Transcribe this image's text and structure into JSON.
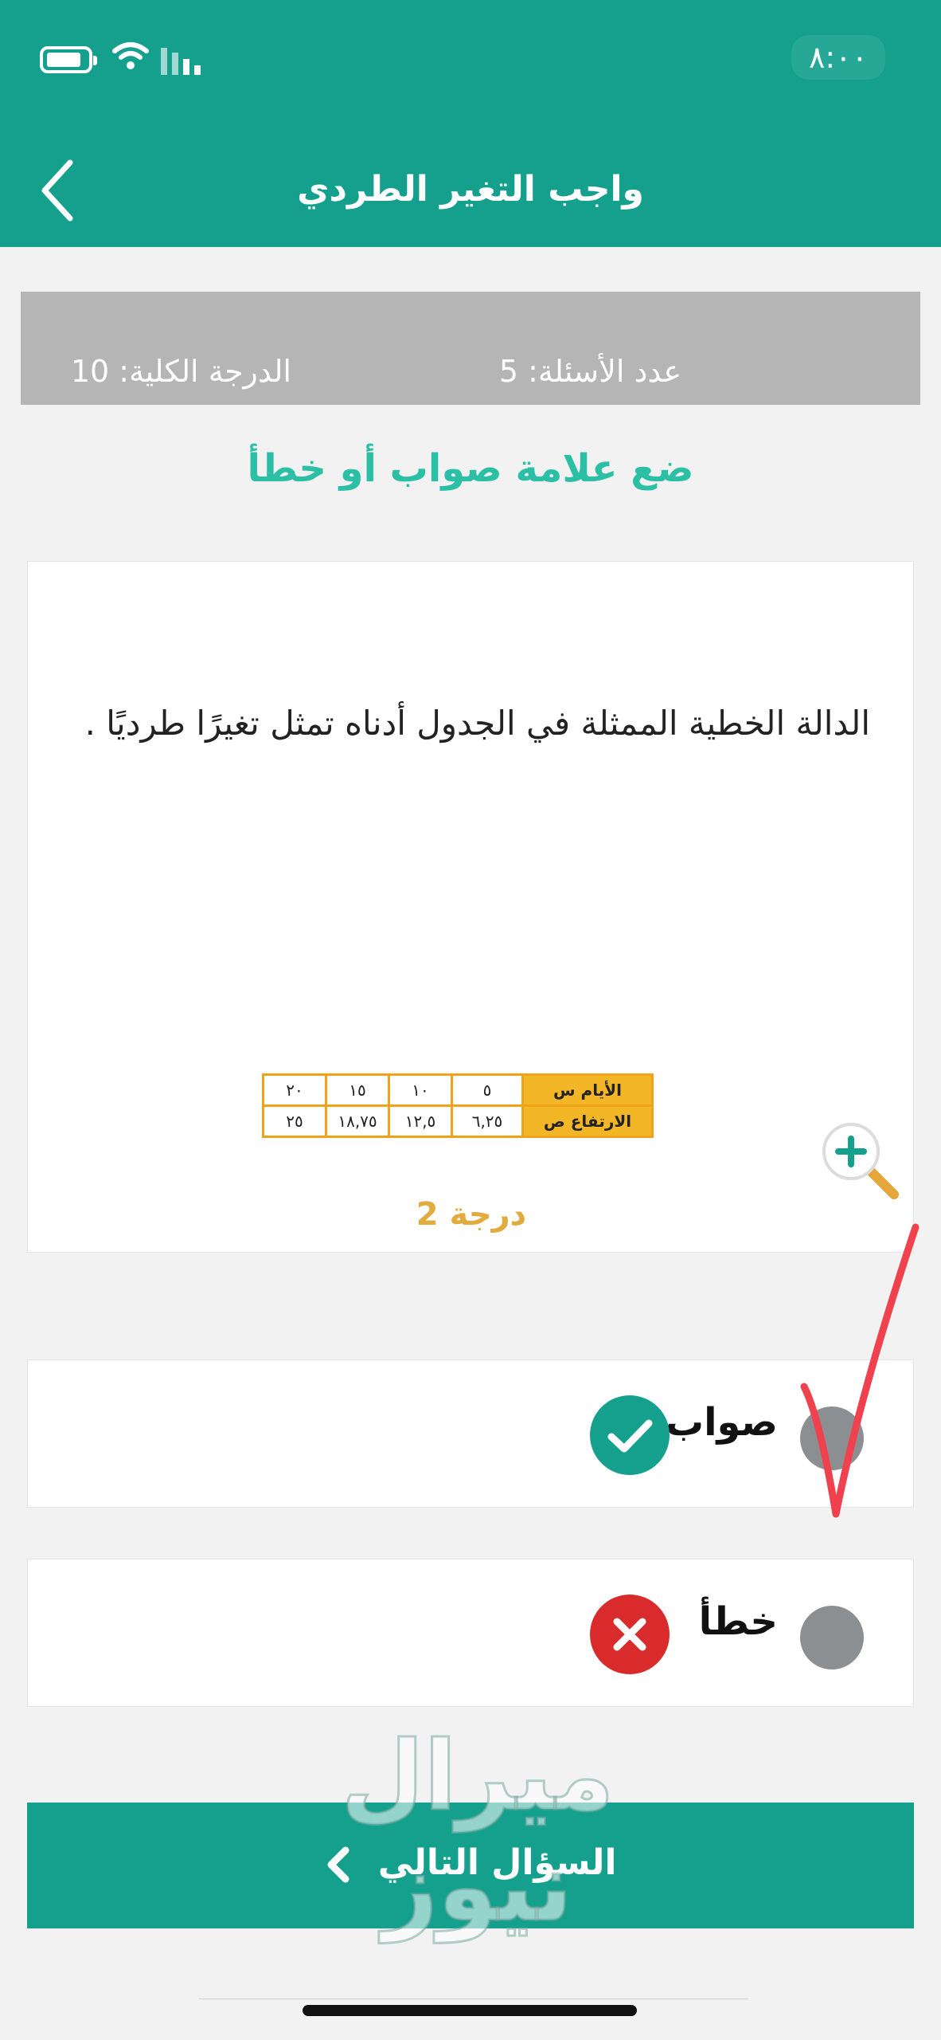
{
  "status_bar": {
    "time": "٨:٠٠",
    "battery_icon": "battery-icon",
    "wifi_icon": "wifi-icon",
    "signal_icon": "signal-icon"
  },
  "header": {
    "title": "واجب التغير الطردي",
    "back_icon": "chevron-left-icon"
  },
  "info_bar": {
    "questions_count": "عدد الأسئلة: 5",
    "total_grade": "الدرجة الكلية: 10"
  },
  "instruction": "ضع علامة صواب أو خطأ",
  "question": {
    "text": "الدالة الخطية الممثلة في الجدول أدناه تمثل تغيرًا طرديًا .",
    "table": {
      "rows": [
        {
          "header": "الأيام س",
          "values": [
            "٥",
            "١٠",
            "١٥",
            "٢٠"
          ]
        },
        {
          "header": "الارتفاع ص",
          "values": [
            "٦,٢٥",
            "١٢,٥",
            "١٨,٧٥",
            "٢٥"
          ]
        }
      ]
    },
    "grade": "درجة 2",
    "zoom_icon": "zoom-in-icon"
  },
  "options": [
    {
      "label": "صواب",
      "icon": "check-icon",
      "badge_color": "#15a08e"
    },
    {
      "label": "خطأ",
      "icon": "close-icon",
      "badge_color": "#d92b2b"
    }
  ],
  "next_button": {
    "label": "السؤال التالي",
    "icon": "chevron-left-icon"
  },
  "watermark": "ميرال نيوز",
  "colors": {
    "primary": "#15a08e",
    "accent": "#2bbfa6",
    "grade": "#e2ab3e",
    "error": "#d92b2b"
  }
}
